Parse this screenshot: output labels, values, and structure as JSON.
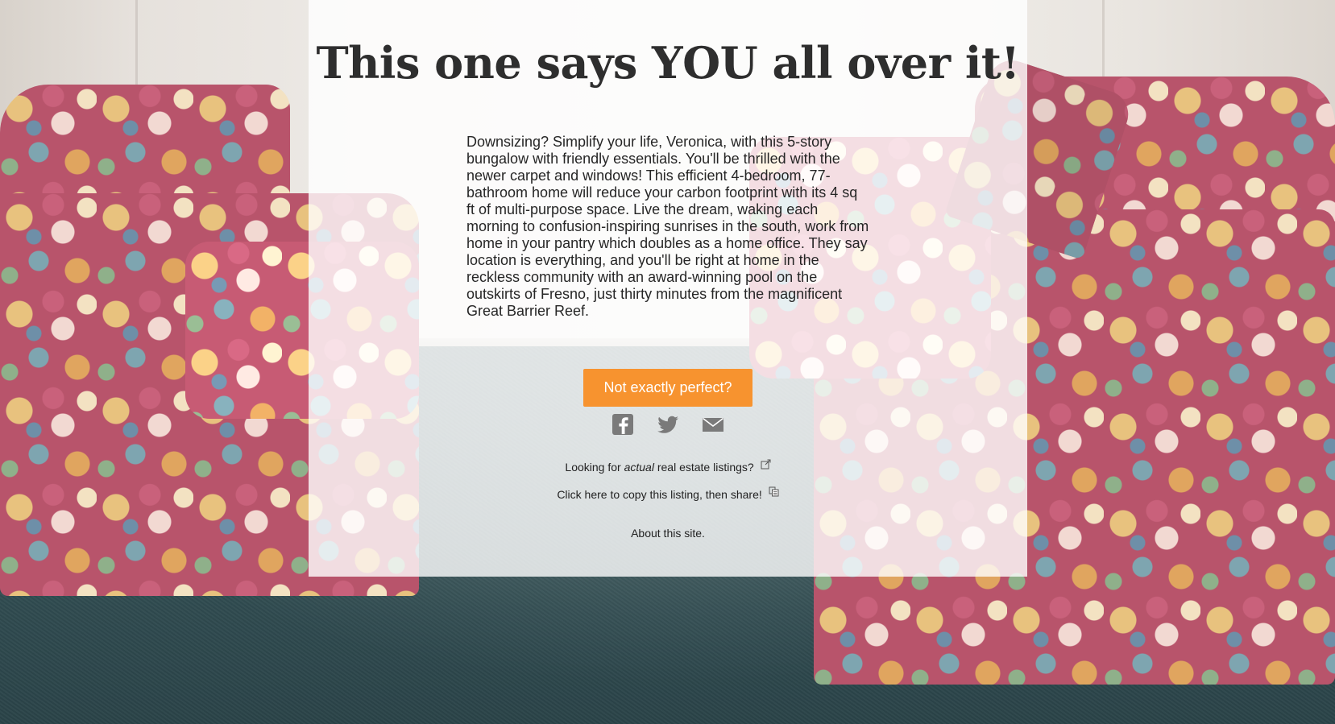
{
  "headline": "This one says YOU all over it!",
  "description": "Downsizing? Simplify your life, Veronica, with this 5-story bungalow with friendly essentials. You'll be thrilled with the newer carpet and windows! This efficient 4-bedroom, 77-bathroom home will reduce your carbon footprint with its 4 sq ft of multi-purpose space. Live the dream, waking each morning to confusion-inspiring sunrises in the south, work from home in your pantry which doubles as a home office. They say location is everything, and you'll be right at home in the reckless community with an award-winning pool on the outskirts of Fresno, just thirty minutes from the magnificent Great Barrier Reef.",
  "cta_button": "Not exactly perfect?",
  "share": {
    "icons": [
      "facebook-icon",
      "twitter-icon",
      "email-icon"
    ]
  },
  "links": {
    "listings_prefix": "Looking for",
    "listings_emphasis": "actual",
    "listings_suffix": "real estate listings?",
    "copy_text": "Click here to copy this listing, then share!",
    "about_text": "About this site."
  },
  "colors": {
    "accent": "#f7932f",
    "panel": "rgba(255,255,255,0.80)",
    "icon_gray": "#7a7a7a"
  }
}
